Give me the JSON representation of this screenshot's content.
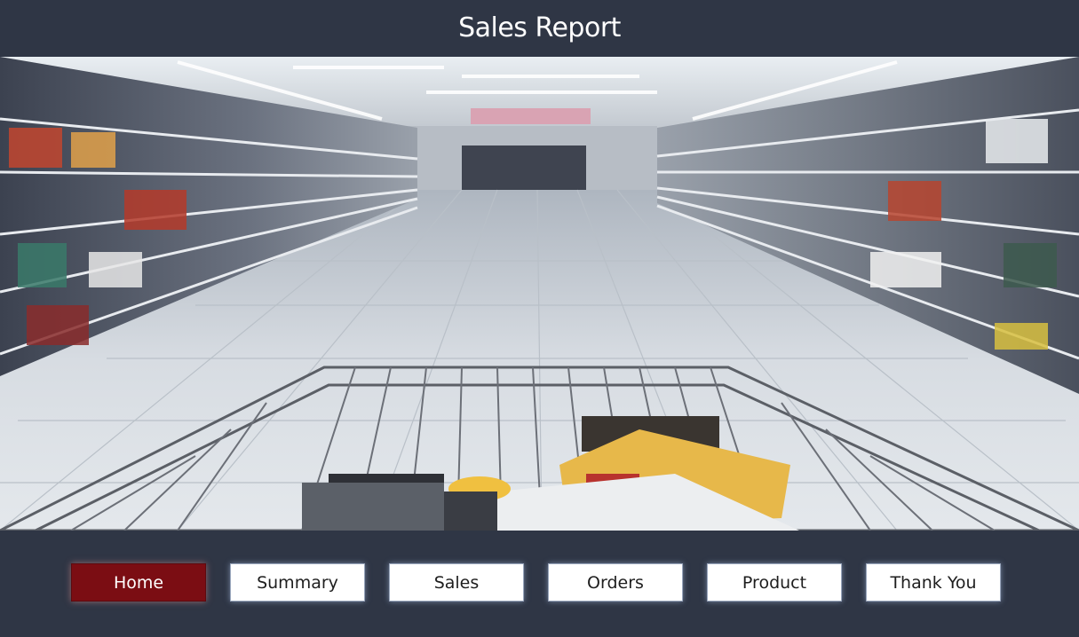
{
  "header": {
    "title": "Sales Report"
  },
  "hero": {
    "image": "supermarket-aisle-shopping-cart"
  },
  "nav": {
    "active": "Home",
    "active_color": "#7b0d13",
    "items": [
      {
        "label": "Home"
      },
      {
        "label": "Summary"
      },
      {
        "label": "Sales"
      },
      {
        "label": "Orders"
      },
      {
        "label": "Product"
      },
      {
        "label": "Thank You"
      }
    ]
  },
  "colors": {
    "background": "#2f3645",
    "button": "#ffffff",
    "active_button": "#7b0d13"
  }
}
